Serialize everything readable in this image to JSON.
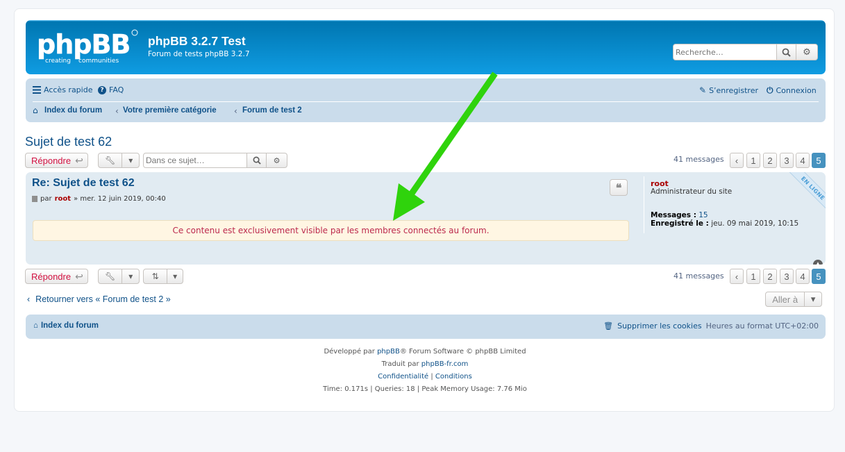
{
  "header": {
    "logo_text": "phpBB",
    "logo_tagline_1": "creating",
    "logo_tagline_2": "communities",
    "site_title": "phpBB 3.2.7 Test",
    "site_description": "Forum de tests phpBB 3.2.7",
    "search_placeholder": "Recherche…"
  },
  "navbar": {
    "quick_access": "Accès rapide",
    "faq": "FAQ",
    "register": "S’enregistrer",
    "login": "Connexion",
    "breadcrumbs": [
      "Index du forum",
      "Votre première catégorie",
      "Forum de test 2"
    ]
  },
  "topic": {
    "title": "Sujet de test 62",
    "reply_label": "Répondre",
    "search_placeholder": "Dans ce sujet…",
    "messages_count": "41 messages",
    "pages": [
      "1",
      "2",
      "3",
      "4",
      "5"
    ],
    "active_page": "5"
  },
  "post": {
    "title": "Re: Sujet de test 62",
    "meta_prefix": "par",
    "author": "root",
    "date": "» mer. 12 juin 2019, 00:40",
    "notice": "Ce contenu est exclusivement visible par les membres connectés au forum.",
    "online_label": "EN LIGNE",
    "profile": {
      "name": "root",
      "rank": "Administrateur du site",
      "messages_label": "Messages :",
      "messages_value": "15",
      "registered_label": "Enregistré le :",
      "registered_value": "jeu. 09 mai 2019, 10:15"
    }
  },
  "bottom": {
    "return_link": "Retourner vers « Forum de test 2 »",
    "jump_label": "Aller à"
  },
  "footer": {
    "index": "Index du forum",
    "delete_cookies": "Supprimer les cookies",
    "timezone": "Heures au format UTC+02:00",
    "credit_prefix": "Développé par",
    "credit_link": "phpBB",
    "credit_suffix": "® Forum Software © phpBB Limited",
    "translated_prefix": "Traduit par",
    "translated_link": "phpBB-fr.com",
    "privacy": "Confidentialité",
    "separator": "|",
    "terms": "Conditions",
    "stats": "Time: 0.171s | Queries: 18 | Peak Memory Usage: 7.76 Mio"
  },
  "colors": {
    "arrow": "#2fd30c",
    "header": "#12a3eb",
    "navbar": "#cadceb",
    "post_bg": "#e1ebf2",
    "notice_text": "#bc2a4d",
    "active_page": "#4692bf"
  }
}
